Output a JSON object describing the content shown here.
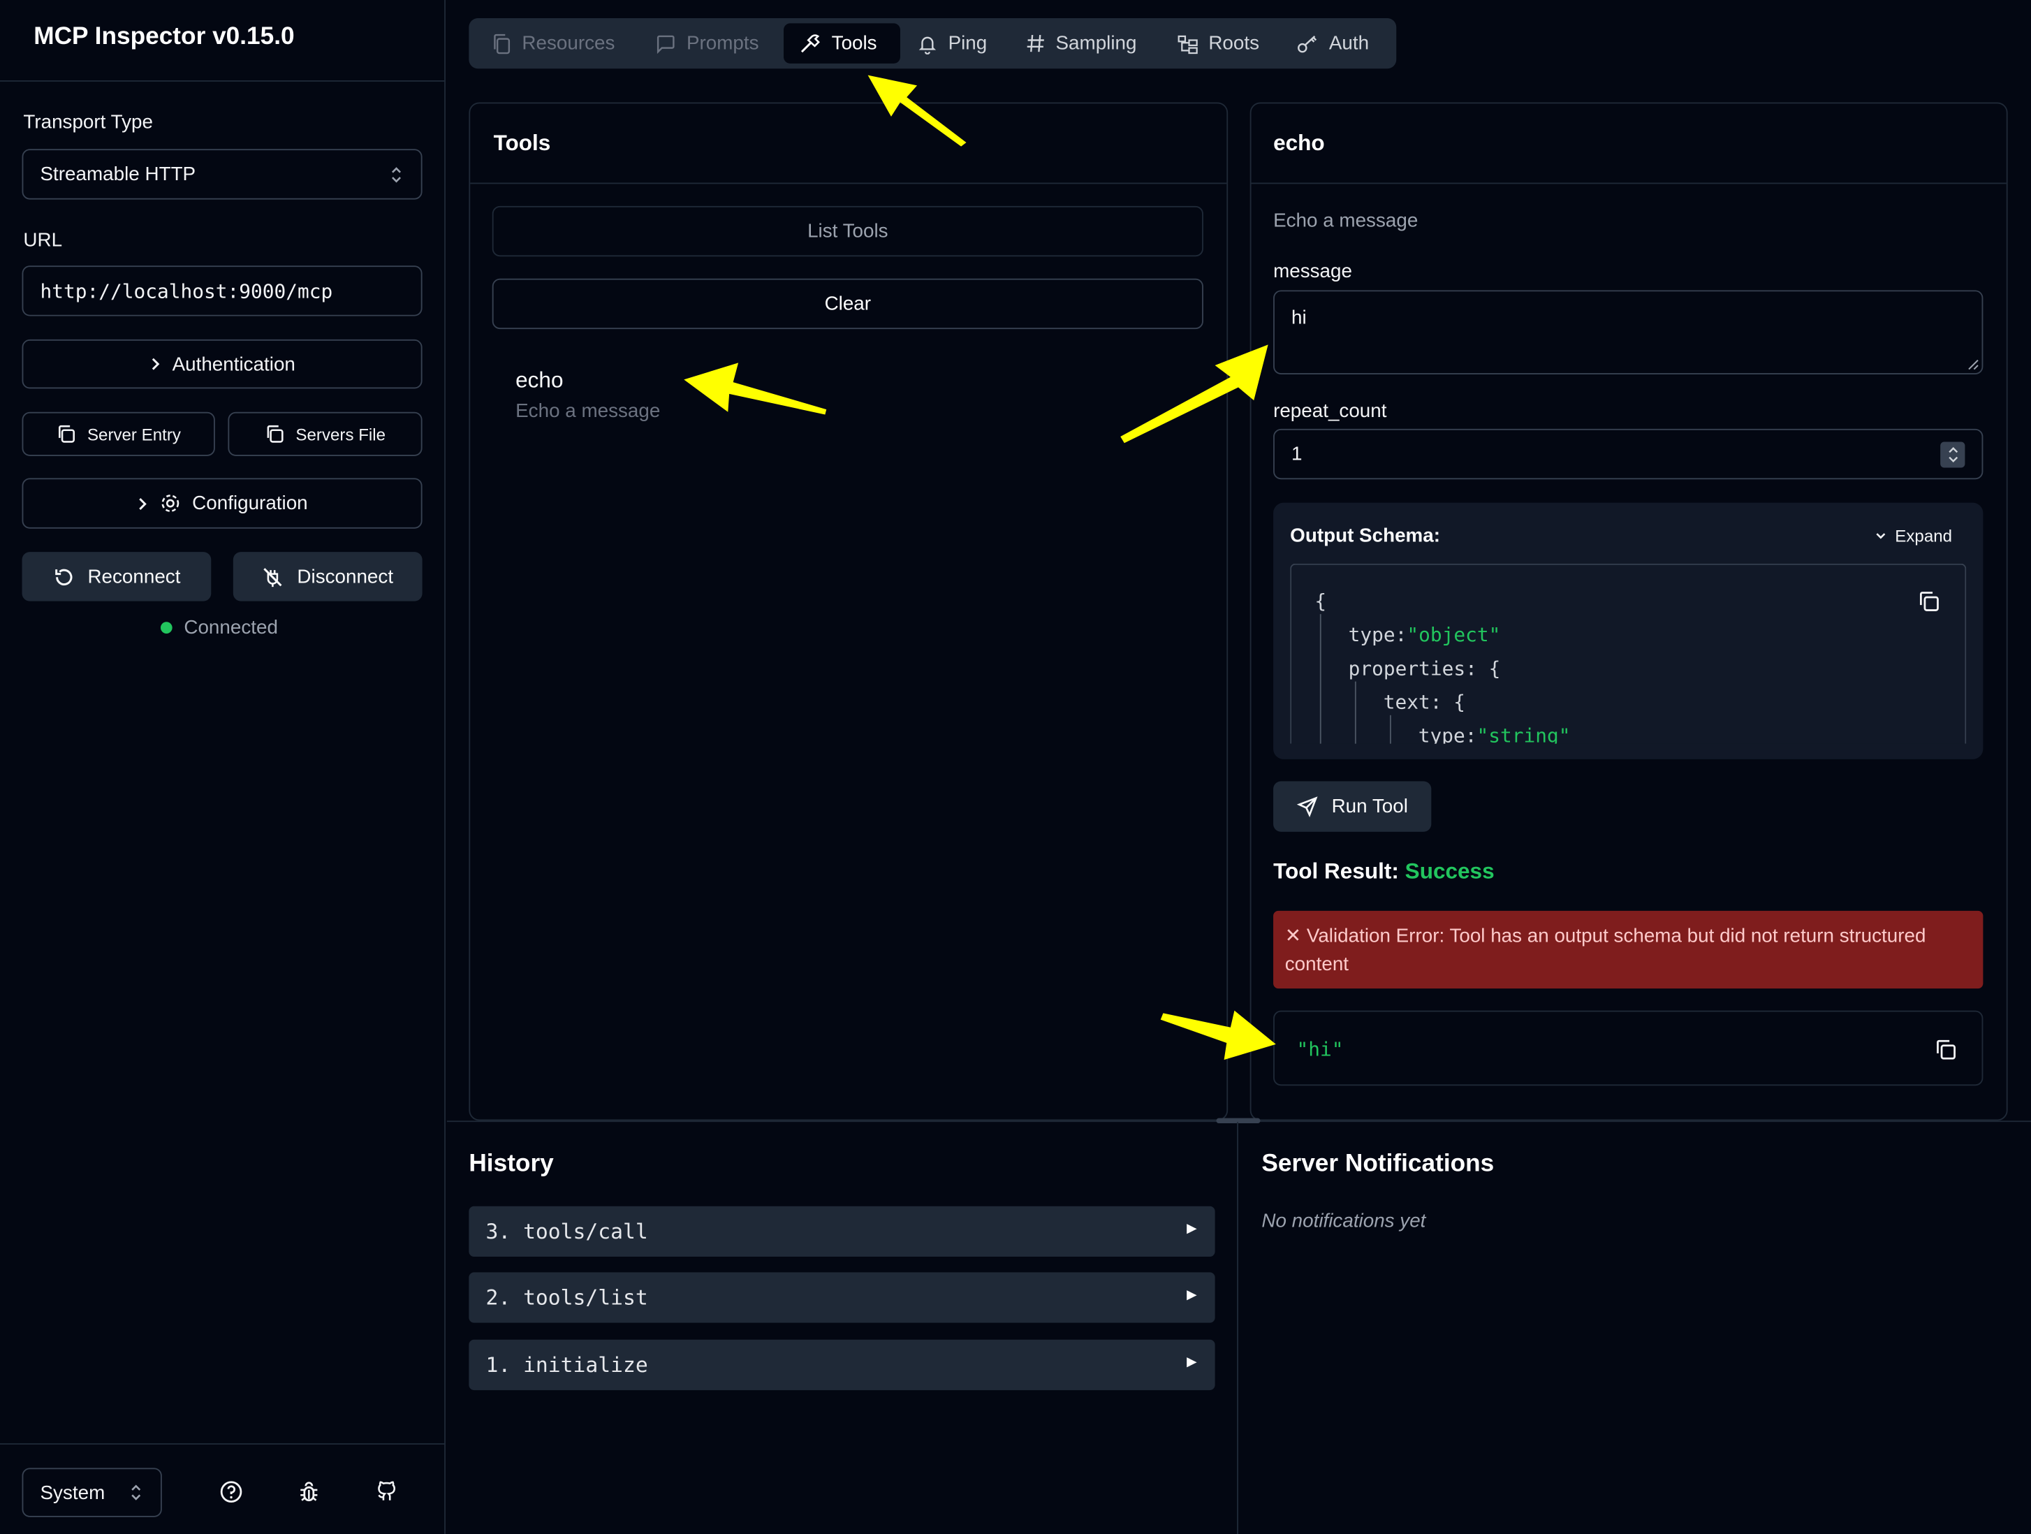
{
  "app": {
    "title": "MCP Inspector v0.15.0"
  },
  "sidebar": {
    "transport_label": "Transport Type",
    "transport_value": "Streamable HTTP",
    "url_label": "URL",
    "url_value": "http://localhost:9000/mcp",
    "authentication": "Authentication",
    "server_entry": "Server Entry",
    "servers_file": "Servers File",
    "configuration": "Configuration",
    "reconnect": "Reconnect",
    "disconnect": "Disconnect",
    "status": "Connected",
    "status_color": "#22c55e",
    "theme_value": "System"
  },
  "tabs": [
    {
      "label": "Resources",
      "icon": "files-icon",
      "state": "disabled"
    },
    {
      "label": "Prompts",
      "icon": "message-square-icon",
      "state": "disabled"
    },
    {
      "label": "Tools",
      "icon": "hammer-icon",
      "state": "active"
    },
    {
      "label": "Ping",
      "icon": "bell-icon",
      "state": "normal"
    },
    {
      "label": "Sampling",
      "icon": "hash-icon",
      "state": "normal"
    },
    {
      "label": "Roots",
      "icon": "folder-tree-icon",
      "state": "normal"
    },
    {
      "label": "Auth",
      "icon": "key-icon",
      "state": "normal"
    }
  ],
  "tools_panel": {
    "title": "Tools",
    "list_tools": "List Tools",
    "clear": "Clear",
    "items": [
      {
        "name": "echo",
        "description": "Echo a message"
      }
    ]
  },
  "tool_detail": {
    "title": "echo",
    "description": "Echo a message",
    "message_label": "message",
    "message_value": "hi",
    "repeat_label": "repeat_count",
    "repeat_value": "1",
    "schema_label": "Output Schema:",
    "expand_label": "Expand",
    "schema_lines": {
      "open": "{",
      "type_key": "type:",
      "type_val": "\"object\"",
      "props_key": "properties:",
      "props_open": "{",
      "text_key": "text:",
      "text_open": "{",
      "inner_type_key": "type:",
      "inner_type_val": "\"string\""
    },
    "run_tool": "Run Tool",
    "result_label": "Tool Result:",
    "result_status": "Success",
    "error_prefix": "✕",
    "error_text": "Validation Error: Tool has an output schema but did not return structured content",
    "result_value": "\"hi\""
  },
  "history": {
    "title": "History",
    "items": [
      {
        "label": "3. tools/call"
      },
      {
        "label": "2. tools/list"
      },
      {
        "label": "1. initialize"
      }
    ]
  },
  "notifications": {
    "title": "Server Notifications",
    "empty": "No notifications yet"
  },
  "colors": {
    "background": "#030712",
    "surface": "#1f2937",
    "success": "#22c55e",
    "error_bg": "#7f1d1d",
    "annotation_arrow": "#ffff00"
  }
}
